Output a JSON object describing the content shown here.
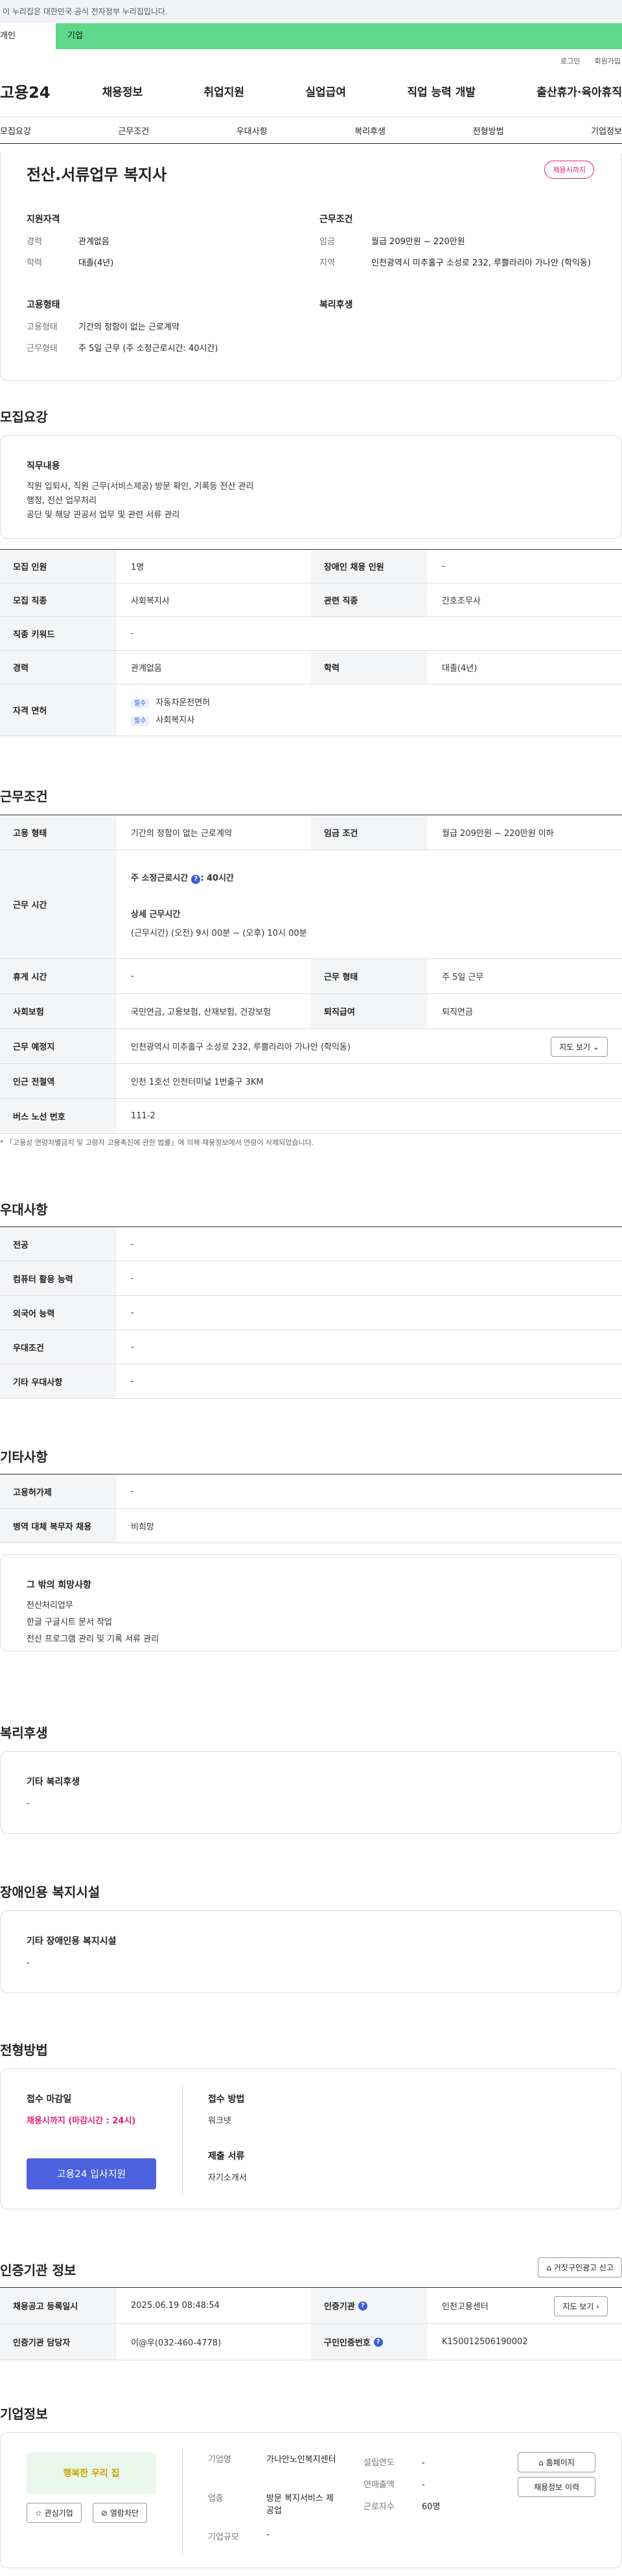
{
  "notice": "이 누리집은 대한민국 공식 전자정부 누리집입니다.",
  "member_tabs": {
    "personal": "개인",
    "corporate": "기업"
  },
  "util": [
    "로그인",
    "회원가입"
  ],
  "logo": "고용24",
  "gnb": [
    "채용정보",
    "취업지원",
    "실업급여",
    "직업 능력 개발",
    "출산휴가·육아휴직"
  ],
  "anchors": [
    "모집요강",
    "근무조건",
    "우대사항",
    "복리후생",
    "전형방법",
    "기업정보"
  ],
  "job": {
    "title": "전산.서류업무 복지사",
    "status": "채용시까지"
  },
  "summary": {
    "qual_head": "지원자격",
    "exp_k": "경력",
    "exp_v": "관계없음",
    "edu_k": "학력",
    "edu_v": "대졸(4년)",
    "work_head": "근무조건",
    "pay_k": "임금",
    "pay_v": "월급 209만원 ~ 220만원",
    "area_k": "지역",
    "area_v": "인천광역시 미추홀구 소성로 232, 루쁠라리아 가나안 (학익동)",
    "emp_head": "고용형태",
    "type_k": "고용형태",
    "type_v": "기간의 정함이 없는 근로계약",
    "form_k": "근무형태",
    "form_v": "주 5일 근무 (주 소정근로시간: 40시간)",
    "welfare_head": "복리후생"
  },
  "recruit": {
    "title": "모집요강",
    "duty_head": "직무내용",
    "duty_lines": [
      "직원 입퇴사, 직원 근무(서비스제공) 방문 확인, 기록등 전산 관리",
      "행정, 전산 업무처리",
      "공단 및 해당 관공서 업무 및 관련 서류 관리"
    ],
    "rows": [
      {
        "k1": "모집 인원",
        "v1": "1명",
        "k2": "장애인 채용 인원",
        "v2": "-"
      },
      {
        "k1": "모집 직종",
        "v1": "사회복지사",
        "k2": "관련 직종",
        "v2": "간호조무사"
      },
      {
        "k1": "직종 키워드",
        "v1": "-"
      },
      {
        "k1": "경력",
        "v1": "관계없음",
        "k2": "학력",
        "v2": "대졸(4년)"
      }
    ],
    "license_k": "자격 면허",
    "lic_chip": "필수",
    "lic1": "자동차운전면허",
    "lic2": "사회복지사"
  },
  "cond": {
    "title": "근무조건",
    "type_k": "고용 형태",
    "type_v": "기간의 정함이 없는 근로계약",
    "pay_k": "임금 조건",
    "pay_v": "월급 209만원 ~ 220만원 이하",
    "hours_k": "근무 시간",
    "hours_main": "주 소정근로시간",
    "hours_val": ": 40시간",
    "detail_head": "상세 근무시간",
    "detail_v": "(근무시간) (오전) 9시 00분 ~ (오후) 10시 00분",
    "rest_k": "휴게 시간",
    "rest_v": "-",
    "form_k": "근무 형태",
    "form_v": "주 5일 근무",
    "ins_k": "사회보험",
    "ins_v": "국민연금, 고용보험, 산재보험, 건강보험",
    "ret_k": "퇴직급여",
    "ret_v": "퇴직연금",
    "place_k": "근무 예정지",
    "place_v": "인천광역시 미추홀구 소성로 232, 루쁠라리아 가나안 (학익동)",
    "map_btn": "지도 보기",
    "sub_k": "인근 전철역",
    "sub_v": "인천 1호선 인천터미널 1번출구 3KM",
    "bus_k": "버스 노선 번호",
    "bus_v": "111-2",
    "footnote": "* 「고용상 연령차별금지 및 고령자 고용촉진에 관한 법률」에 의해 채용정보에서 연령이 삭제되었습니다."
  },
  "pref": {
    "title": "우대사항",
    "rows": [
      {
        "k": "전공",
        "v": "-"
      },
      {
        "k": "컴퓨터 활용 능력",
        "v": "-"
      },
      {
        "k": "외국어 능력",
        "v": "-"
      },
      {
        "k": "우대조건",
        "v": "-"
      },
      {
        "k": "기타 우대사항",
        "v": "-"
      }
    ]
  },
  "etc": {
    "title": "기타사항",
    "rows": [
      {
        "k": "고용허가제",
        "v": "-"
      },
      {
        "k": "병역 대체 복무자 채용",
        "v": "비희망"
      }
    ],
    "other_head": "그 밖의 희망사항",
    "other_lines": [
      "전산처리업무",
      "한글 구글시트 문서 작업",
      "전산 프로그램 관리 및 기록 서류 관리"
    ]
  },
  "welfare": {
    "title": "복리후생",
    "head": "기타 복리후생",
    "v": "-"
  },
  "disab": {
    "title": "장애인용 복지시설",
    "head": "기타 장애인용 복지시설",
    "v": "-"
  },
  "process": {
    "title": "전형방법",
    "deadline_head": "접수 마감일",
    "deadline_v": "채용시까지 (마감시간 : 24시)",
    "apply_btn": "고용24 입사지원",
    "method_head": "접수 방법",
    "method_v": "워크넷",
    "docs_head": "제출 서류",
    "docs_v": "자기소개서"
  },
  "agency": {
    "title": "인증기관 정보",
    "report_btn": "거짓구인광고 신고",
    "reg_k": "채용공고 등록일시",
    "reg_v": "2025.06.19 08:48:54",
    "org_k": "인증기관",
    "org_v": "인천고용센터",
    "map_btn": "지도 보기",
    "mgr_k": "인증기관 담당자",
    "mgr_v": "이@우(032-460-4778)",
    "num_k": "구인인증번호",
    "num_v": "K150012506190002"
  },
  "company": {
    "title": "기업정보",
    "logo_text": "행복한 우리 집",
    "fav_btn": "관심기업",
    "block_btn": "열람차단",
    "name_k": "기업명",
    "name_v": "가나안노인복지센터",
    "year_k": "설립연도",
    "year_v": "-",
    "ind_k": "업종",
    "ind_v": "방문 복지서비스 제공업",
    "sales_k": "연매출액",
    "sales_v": "-",
    "emp_k": "근로자수",
    "emp_v": "60명",
    "size_k": "기업규모",
    "size_v": "-",
    "home_btn": "홈페이지",
    "jobs_btn": "채용정보 이력"
  }
}
